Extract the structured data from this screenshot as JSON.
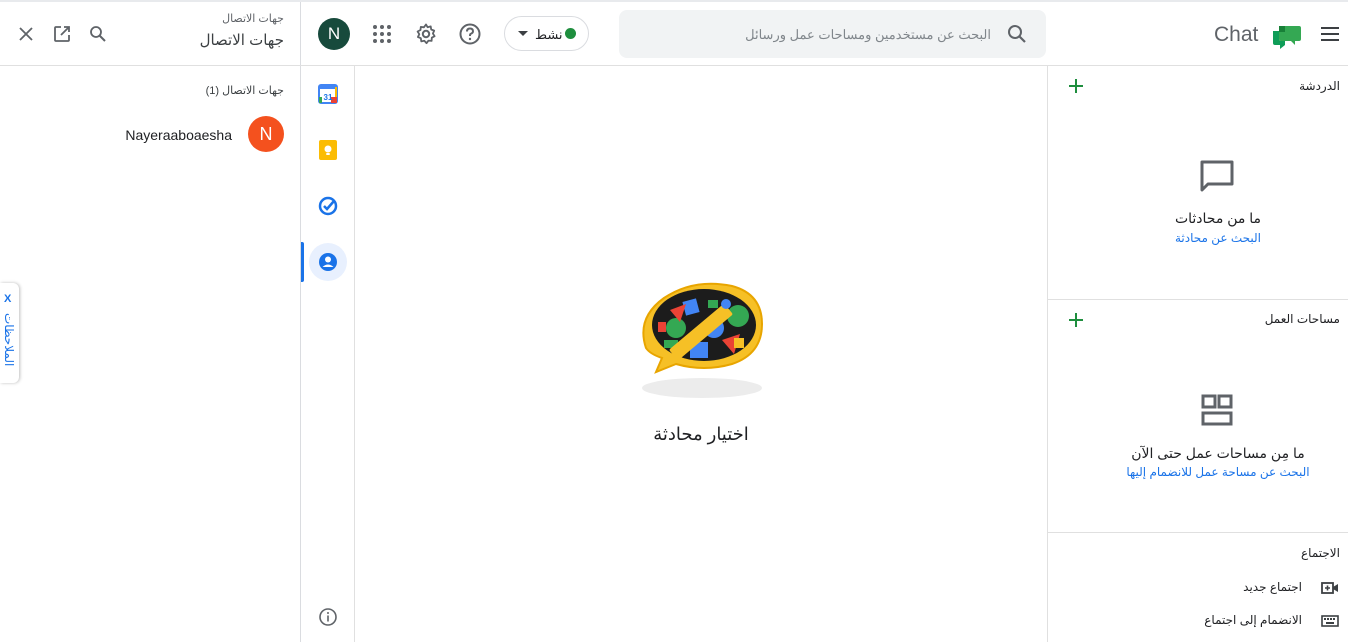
{
  "contacts_panel": {
    "small_title": "جهات الاتصال",
    "title": "جهات الاتصال",
    "count_label": "جهات الاتصال (1)",
    "contacts": [
      {
        "initial": "N",
        "name": "Nayeraaboaesha",
        "avatar_color": "#f4511e"
      }
    ]
  },
  "notes_tab": {
    "close": "X",
    "label": "الملاحظات"
  },
  "topbar": {
    "avatar_initial": "N",
    "status_label": "نشط",
    "status_color": "#1e8e3e",
    "search_placeholder": "البحث عن مستخدمين ومساحات عمل ورسائل",
    "app_name": "Chat"
  },
  "center": {
    "empty_title": "اختيار محادثة"
  },
  "right_panel": {
    "chat_section": {
      "title": "الدردشة",
      "empty_title": "ما من محادثات",
      "empty_link": "البحث عن محادثة"
    },
    "spaces_section": {
      "title": "مساحات العمل",
      "empty_title": "ما مِن مساحات عمل حتى الآن",
      "empty_link": "البحث عن مساحة عمل للانضمام إليها"
    },
    "meet_section": {
      "title": "الاجتماع",
      "new_meeting": "اجتماع جديد",
      "join_meeting": "الانضمام إلى اجتماع"
    }
  },
  "colors": {
    "accent": "#1a73e8",
    "green": "#1e8e3e",
    "avatar_dark": "#174a3c"
  }
}
